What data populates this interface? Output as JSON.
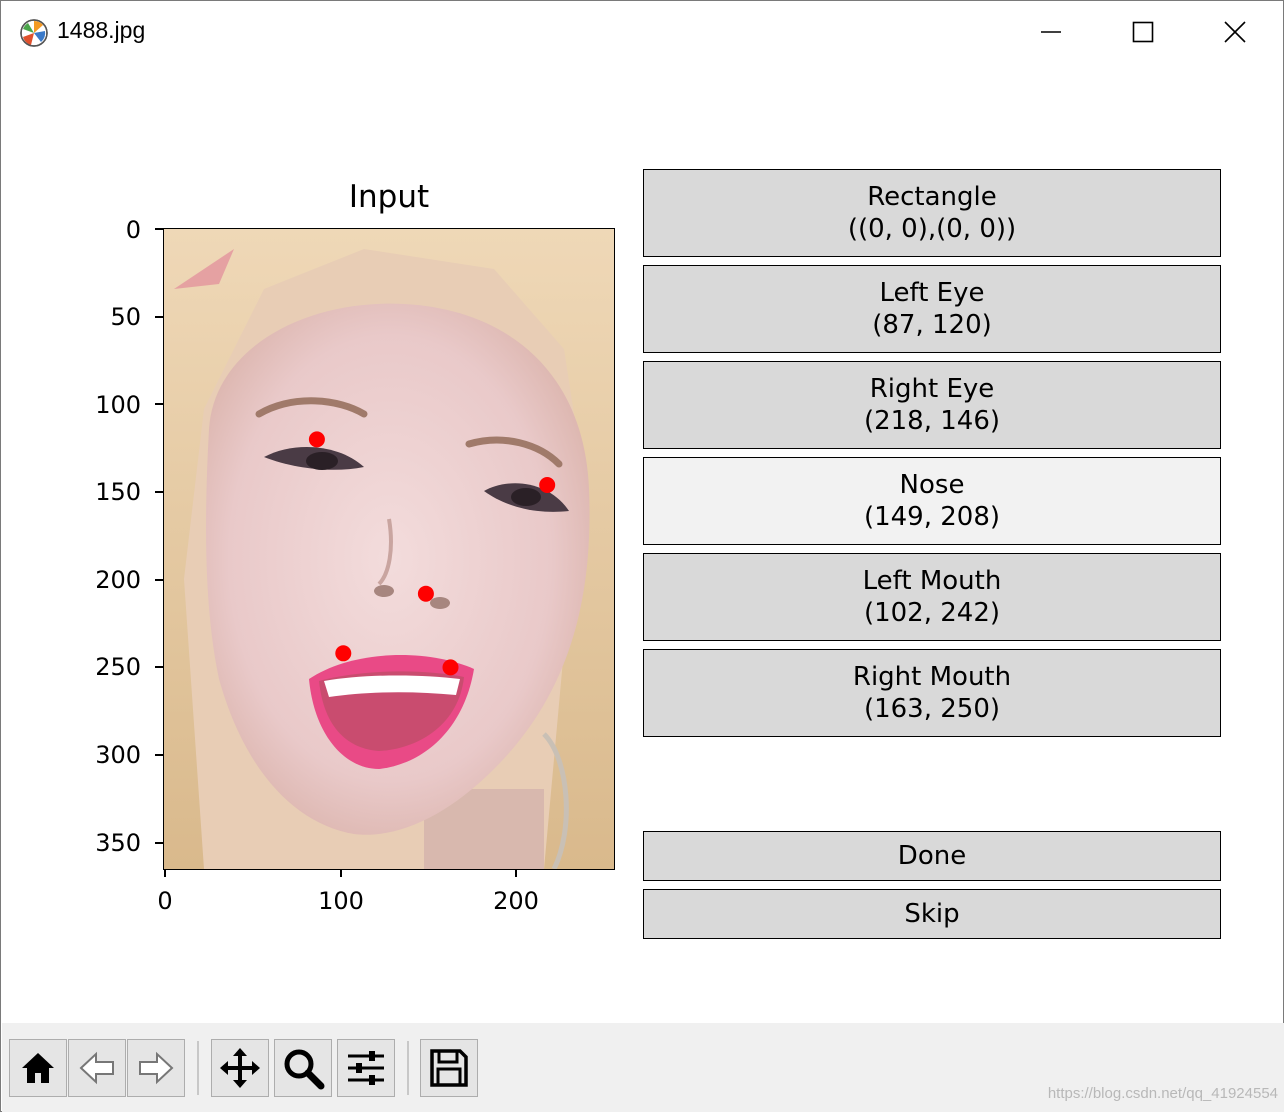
{
  "window": {
    "title": "1488.jpg"
  },
  "plot": {
    "title": "Input",
    "yticks": [
      "0",
      "50",
      "100",
      "150",
      "200",
      "250",
      "300",
      "350"
    ],
    "xticks": [
      "0",
      "100",
      "200"
    ],
    "landmark_color": "#ff0000",
    "landmarks": [
      {
        "x": 87,
        "y": 120
      },
      {
        "x": 218,
        "y": 146
      },
      {
        "x": 149,
        "y": 208
      },
      {
        "x": 102,
        "y": 242
      },
      {
        "x": 163,
        "y": 250
      }
    ]
  },
  "buttons": {
    "rectangle": {
      "label": "Rectangle",
      "value": "((0, 0),(0, 0))"
    },
    "left_eye": {
      "label": "Left Eye",
      "value": "(87, 120)"
    },
    "right_eye": {
      "label": "Right Eye",
      "value": "(218, 146)"
    },
    "nose": {
      "label": "Nose",
      "value": "(149, 208)"
    },
    "left_mouth": {
      "label": "Left Mouth",
      "value": "(102, 242)"
    },
    "right_mouth": {
      "label": "Right Mouth",
      "value": "(163, 250)"
    },
    "done": "Done",
    "skip": "Skip"
  },
  "toolbar": {
    "icons": [
      "home-icon",
      "back-arrow-icon",
      "forward-arrow-icon",
      "pan-icon",
      "zoom-icon",
      "configure-subplots-icon",
      "save-icon"
    ]
  },
  "watermark": "https://blog.csdn.net/qq_41924554"
}
